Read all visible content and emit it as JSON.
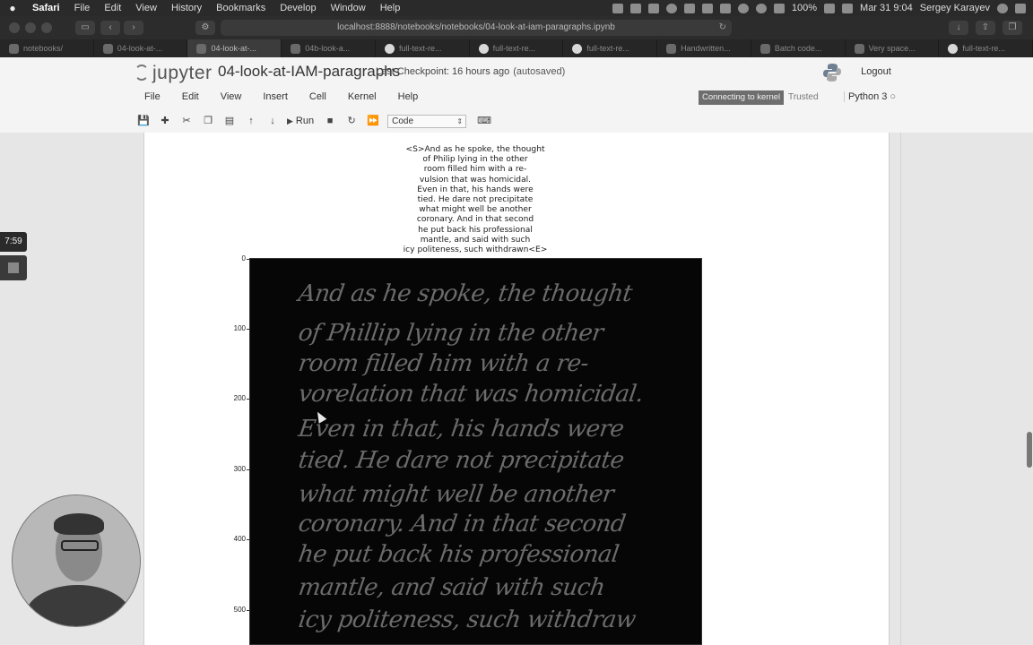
{
  "menubar": {
    "items": [
      "Safari",
      "File",
      "Edit",
      "View",
      "History",
      "Bookmarks",
      "Develop",
      "Window",
      "Help"
    ],
    "battery": "100%",
    "datetime": "Mar 31  9:04",
    "user": "Sergey Karayev"
  },
  "browser": {
    "url": "localhost:8888/notebooks/notebooks/04-look-at-iam-paragraphs.ipynb",
    "tabs": [
      {
        "label": "notebooks/",
        "icon": "page-icon"
      },
      {
        "label": "04-look-at-...",
        "icon": "page-icon"
      },
      {
        "label": "04-look-at-...",
        "icon": "page-icon",
        "active": true
      },
      {
        "label": "04b-look-a...",
        "icon": "page-icon"
      },
      {
        "label": "full-text-re...",
        "icon": "github-icon"
      },
      {
        "label": "full-text-re...",
        "icon": "github-icon"
      },
      {
        "label": "full-text-re...",
        "icon": "github-icon"
      },
      {
        "label": "Handwritten...",
        "icon": "page-icon"
      },
      {
        "label": "Batch code...",
        "icon": "page-icon"
      },
      {
        "label": "Very space...",
        "icon": "page-icon"
      },
      {
        "label": "full-text-re...",
        "icon": "github-icon"
      }
    ]
  },
  "jupyter": {
    "logo_text": "jupyter",
    "notebook_title": "04-look-at-IAM-paragraphs",
    "checkpoint": "Last Checkpoint: 16 hours ago",
    "autosaved": "(autosaved)",
    "logout": "Logout",
    "menu": [
      "File",
      "Edit",
      "View",
      "Insert",
      "Cell",
      "Kernel",
      "Help"
    ],
    "kernel_status": "Connecting to kernel",
    "trusted": "Trusted",
    "kernel_name": "Python 3",
    "toolbar": {
      "run_label": "Run",
      "cell_type": "Code"
    }
  },
  "output": {
    "transcript_lines": [
      "<S>And as he spoke, the thought",
      "of Philip lying in the other",
      "room filled him with a re-",
      "vulsion that was homicidal.",
      "Even in that, his hands were",
      "tied. He dare not precipitate",
      "what might well be another",
      "coronary. And in that second",
      "he put back his professional",
      "mantle, and said with such",
      "icy politeness, such withdrawn<E>"
    ],
    "y_ticks": [
      "0",
      "100",
      "200",
      "300",
      "400",
      "500"
    ],
    "handwriting_lines": [
      "And as he spoke, the thought",
      "of Phillip lying in the other",
      "room filled him with a re-",
      "vorelation that was homicidal.",
      "Even in that, his hands were",
      "tied. He dare not precipitate",
      "what might well be another",
      "coronary. And in that second",
      "he put back his professional",
      "mantle, and said with such",
      "icy politeness, such withdraw"
    ]
  },
  "overlay": {
    "timer": "7:59"
  }
}
